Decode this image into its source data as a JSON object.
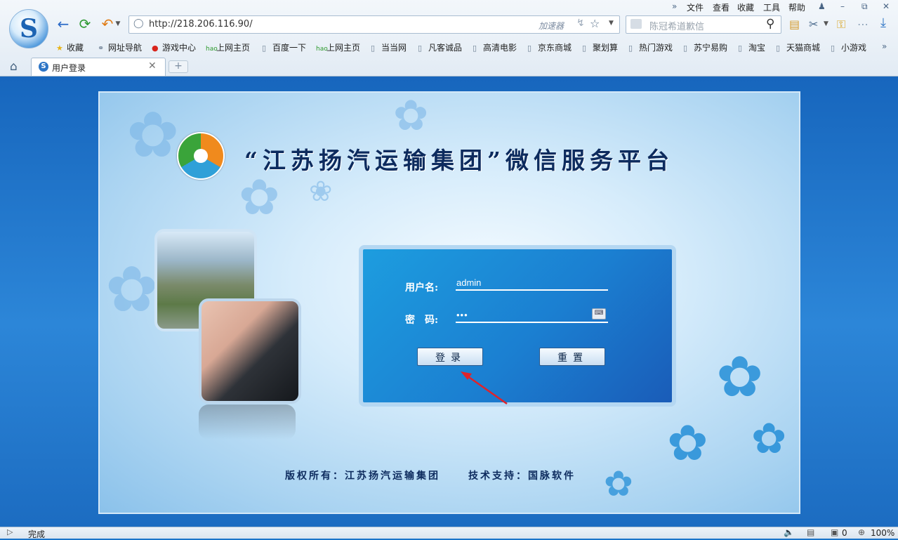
{
  "browser": {
    "logo_glyph": "S",
    "url": "http://218.206.116.90/",
    "accelerator_label": "加速器",
    "search_placeholder": "陈冠希道歉信",
    "menu": [
      "文件",
      "查看",
      "收藏",
      "工具",
      "帮助"
    ],
    "favorites": [
      "收藏",
      "网址导航",
      "游戏中心",
      "上网主页",
      "百度一下",
      "上网主页",
      "当当网",
      "凡客诚品",
      "高清电影",
      "京东商城",
      "聚划算",
      "热门游戏",
      "苏宁易购",
      "淘宝",
      "天猫商城",
      "小游戏"
    ],
    "tab": {
      "title": "用户登录",
      "favicon_glyph": "S"
    },
    "status": {
      "text": "完成",
      "ad_count": "0",
      "zoom": "100%"
    }
  },
  "page": {
    "title": "“江苏扬汽运输集团”微信服务平台",
    "username_label": "用户名:",
    "username_value": "admin",
    "password_label": "密　码:",
    "password_value": "•••",
    "login_button": "登录",
    "reset_button": "重置",
    "footer_copyright": "版权所有：江苏扬汽运输集团",
    "footer_support": "技术支持：国脉软件"
  },
  "colors": {
    "page_bg": "#1a74c9",
    "panel": "#1b7fd1",
    "title_text": "#0d2b5e",
    "arrow": "#e0232a"
  }
}
